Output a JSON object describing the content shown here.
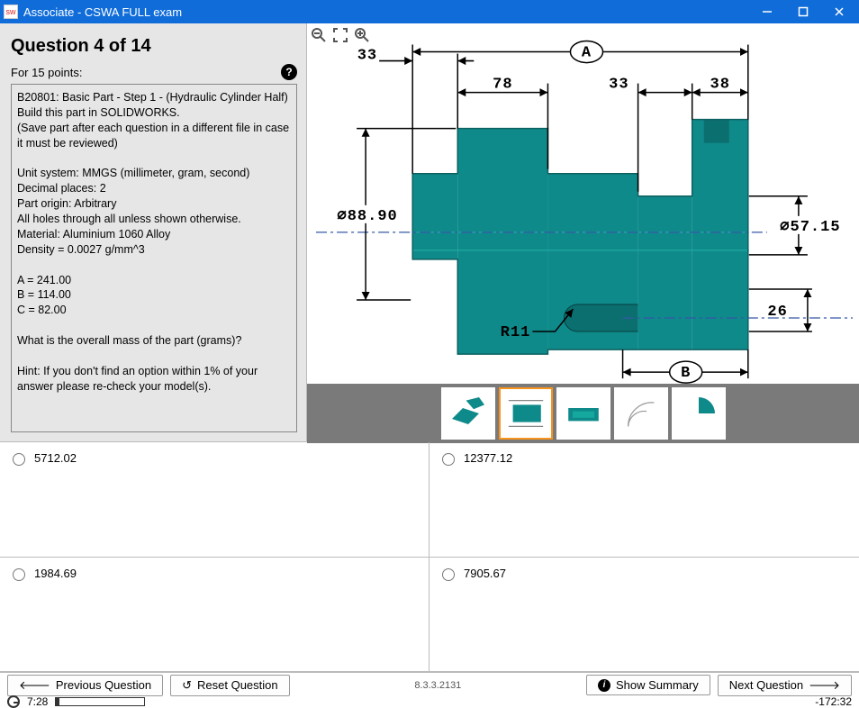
{
  "window": {
    "title": "Associate - CSWA FULL exam"
  },
  "question": {
    "title": "Question 4 of 14",
    "points_label": "For 15 points:",
    "body_lines": [
      "B20801:  Basic Part - Step 1 - (Hydraulic Cylinder Half)",
      "Build this part in SOLIDWORKS.",
      "(Save part after each question in a different file in case it must be reviewed)",
      "",
      "Unit system: MMGS (millimeter, gram, second)",
      "Decimal places: 2",
      "Part origin: Arbitrary",
      "All holes through all unless shown otherwise.",
      "Material: Aluminium 1060 Alloy",
      "Density = 0.0027 g/mm^3",
      "",
      "A = 241.00",
      "B = 114.00",
      "C = 82.00",
      "",
      "What is the overall mass of the part (grams)?",
      "",
      "Hint: If you don't find an option within 1% of your answer please re-check your model(s)."
    ]
  },
  "drawing": {
    "dims": {
      "top_leader": "33",
      "A": "A",
      "d78": "78",
      "d33": "33",
      "d38": "38",
      "dia8890": "∅88.90",
      "dia5715": "∅57.15",
      "r11": "R11",
      "d26": "26",
      "B": "B"
    }
  },
  "answers": {
    "a": "5712.02",
    "b": "12377.12",
    "c": "1984.69",
    "d": "7905.67"
  },
  "buttons": {
    "prev": "Previous Question",
    "reset": "Reset Question",
    "summary": "Show Summary",
    "next": "Next Question"
  },
  "footer": {
    "version": "8.3.3.2131",
    "elapsed": "7:28",
    "remaining": "-172:32"
  }
}
